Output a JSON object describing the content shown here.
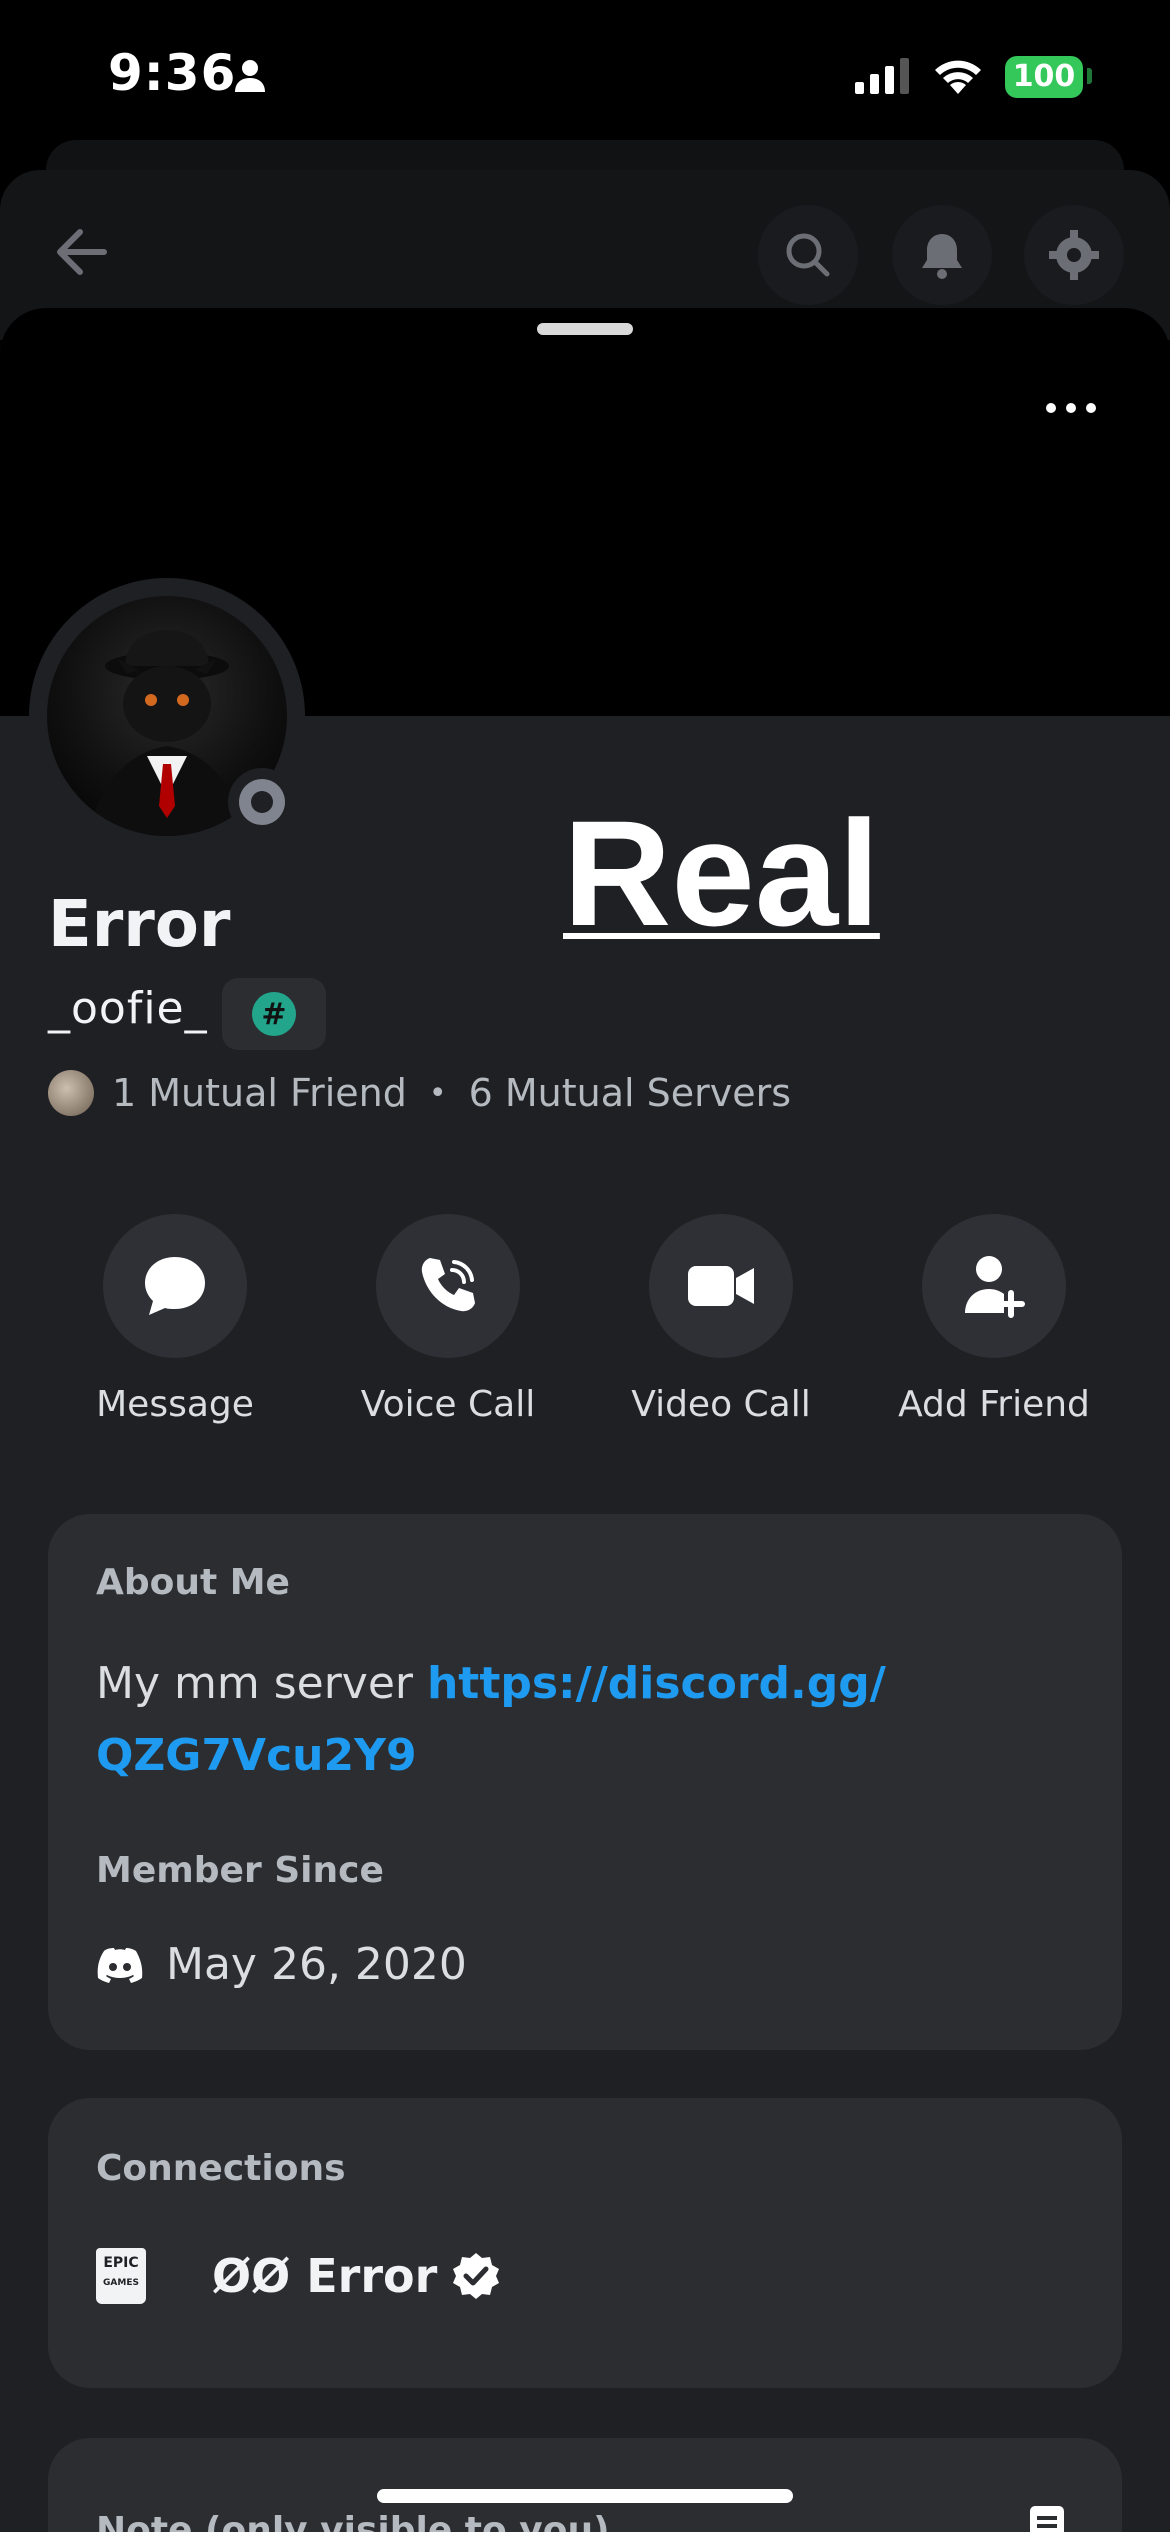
{
  "status_bar": {
    "time": "9:36",
    "battery": "100"
  },
  "overlay_text": "Real",
  "profile": {
    "display_name": "Error",
    "username": "_oofie_",
    "tag_badge": "#",
    "mutual_friends": "1 Mutual Friend",
    "separator": "•",
    "mutual_servers": "6 Mutual Servers"
  },
  "actions": [
    {
      "label": "Message",
      "icon": "chat-bubble-icon"
    },
    {
      "label": "Voice Call",
      "icon": "phone-icon"
    },
    {
      "label": "Video Call",
      "icon": "video-camera-icon"
    },
    {
      "label": "Add Friend",
      "icon": "add-person-icon"
    }
  ],
  "about": {
    "heading": "About Me",
    "text": "My mm server ",
    "link": "https://discord.gg/QZG7Vcu2Y9"
  },
  "member_since": {
    "heading": "Member Since",
    "date": "May 26, 2020"
  },
  "connections": {
    "heading": "Connections",
    "items": [
      {
        "service": "Epic Games",
        "logo_text": "EPIC GAMES",
        "name": "ØØ Error"
      }
    ]
  },
  "note": {
    "heading": "Note (only visible to you)"
  },
  "colors": {
    "accent_link": "#1e9bf0",
    "tag_green": "#23a58c",
    "battery_green": "#34c759",
    "card_bg": "#2b2d31",
    "sheet_bg": "#1f2024"
  }
}
